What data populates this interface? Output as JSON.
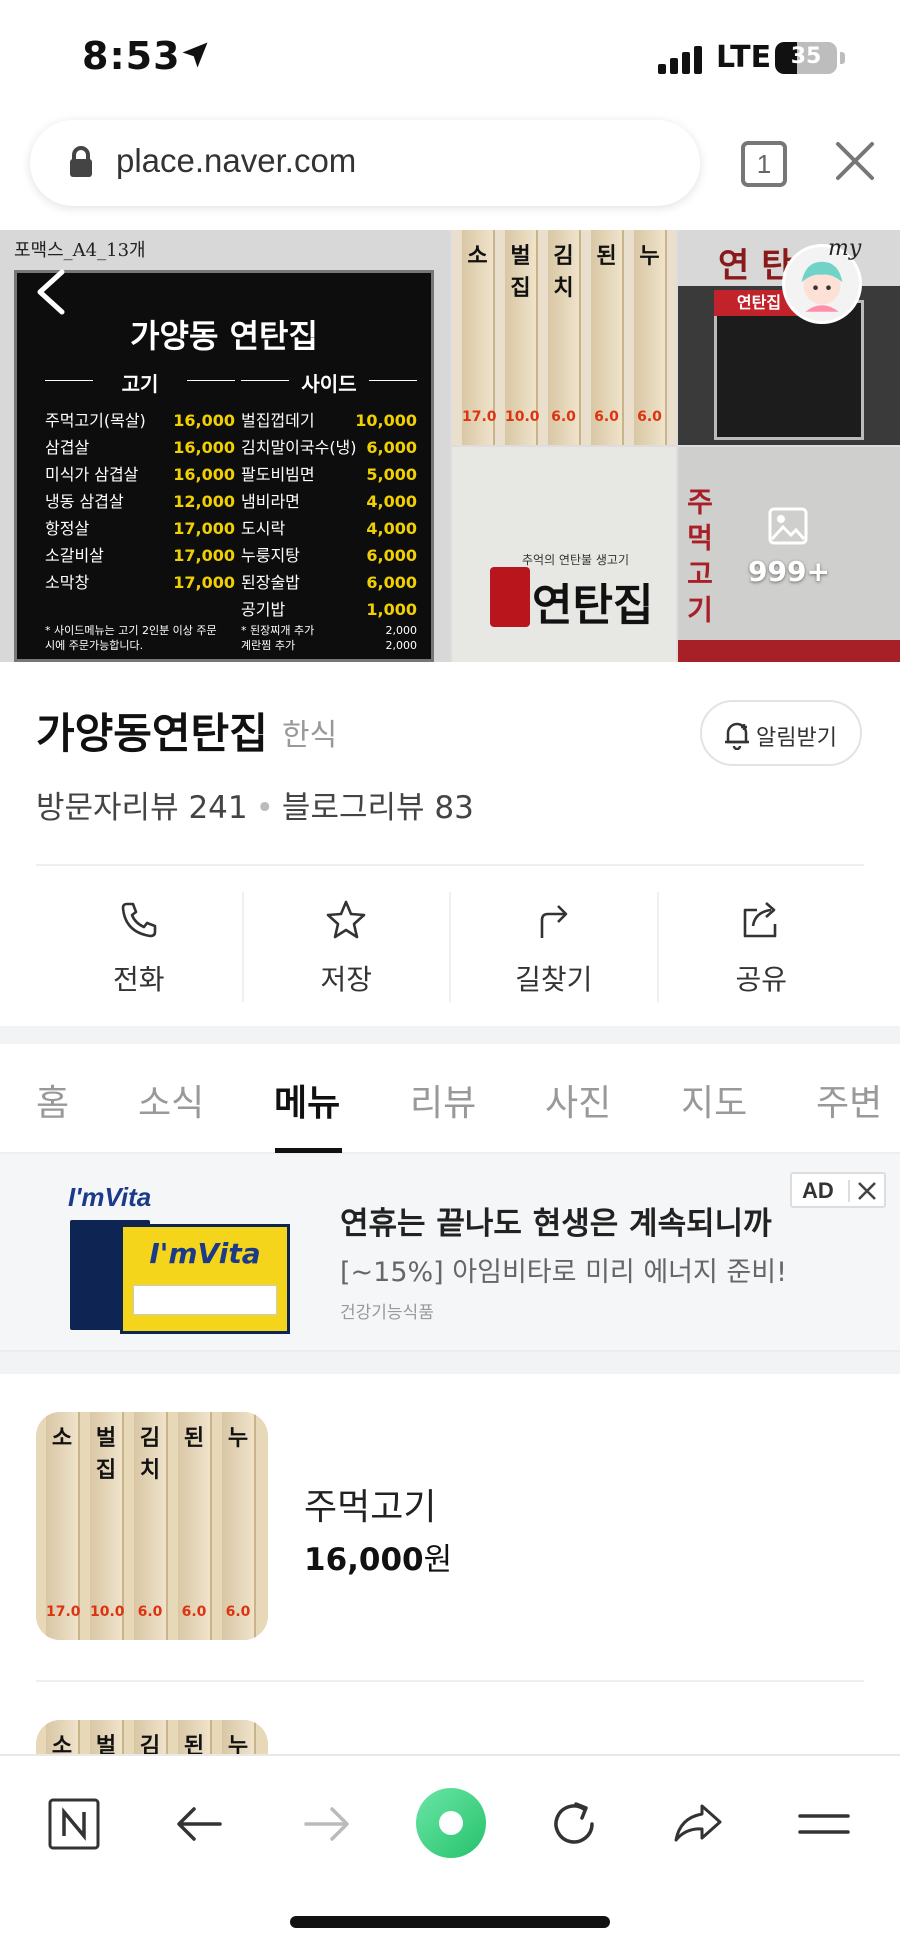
{
  "status_bar": {
    "time": "8:53",
    "network": "LTE",
    "battery_level": "35",
    "battery_fraction": 0.35
  },
  "browser": {
    "url": "place.naver.com",
    "tab_count": "1"
  },
  "photos": {
    "poster_caption": "포맥스_A4_13개",
    "poster_title": "가양동 연탄집",
    "meat_heading": "고기",
    "side_heading": "사이드",
    "meat_items": [
      {
        "name": "주먹고기(목살)",
        "price": "16,000"
      },
      {
        "name": "삼겹살",
        "price": "16,000"
      },
      {
        "name": "미식가 삼겹살",
        "price": "16,000"
      },
      {
        "name": "냉동 삼겹살",
        "price": "12,000"
      },
      {
        "name": "항정살",
        "price": "17,000"
      },
      {
        "name": "소갈비살",
        "price": "17,000"
      },
      {
        "name": "소막창",
        "price": "17,000"
      }
    ],
    "side_items": [
      {
        "name": "벌집껍데기",
        "price": "10,000"
      },
      {
        "name": "김치말이국수(냉)",
        "price": "6,000"
      },
      {
        "name": "팔도비빔면",
        "price": "5,000"
      },
      {
        "name": "냄비라면",
        "price": "4,000"
      },
      {
        "name": "도시락",
        "price": "4,000"
      },
      {
        "name": "누룽지탕",
        "price": "6,000"
      },
      {
        "name": "된장술밥",
        "price": "6,000"
      },
      {
        "name": "공기밥",
        "price": "1,000"
      }
    ],
    "poster_note_left": "* 사이드메뉴는 고기 2인분 이상 주문시에 주문가능합니다.",
    "poster_note_right": [
      {
        "name": "* 된장찌개 추가",
        "price": "2,000"
      },
      {
        "name": "계란찜 추가",
        "price": "2,000"
      }
    ],
    "strip_chars": [
      "소",
      "벌집",
      "김치",
      "된",
      "누"
    ],
    "strip_prices": [
      "17.0",
      "10.0",
      "6.0",
      "6.0",
      "6.0"
    ],
    "store_sign": "연탄집",
    "store_banner": "연탄집",
    "my_label": "my",
    "wall_small_text": "추억의 연탄불 생고기",
    "wall_big_text": "연탄집",
    "red_chars": "주먹고기",
    "more_count": "999+"
  },
  "place": {
    "name": "가양동연탄집",
    "category": "한식",
    "alarm_label": "알림받기",
    "visitor_reviews": "방문자리뷰 241",
    "blog_reviews": "블로그리뷰 83"
  },
  "actions": [
    {
      "label": "전화",
      "icon": "phone-icon"
    },
    {
      "label": "저장",
      "icon": "star-icon"
    },
    {
      "label": "길찾기",
      "icon": "directions-icon"
    },
    {
      "label": "공유",
      "icon": "share-icon"
    }
  ],
  "tabs": [
    {
      "label": "홈",
      "active": false
    },
    {
      "label": "소식",
      "active": false
    },
    {
      "label": "메뉴",
      "active": true
    },
    {
      "label": "리뷰",
      "active": false
    },
    {
      "label": "사진",
      "active": false
    },
    {
      "label": "지도",
      "active": false
    },
    {
      "label": "주변",
      "active": false
    }
  ],
  "ad": {
    "brand": "I'mVita",
    "title": "연휴는 끝나도 현생은 계속되니까",
    "description": "[~15%] 아임비타로 미리 에너지 준비!",
    "sub": "건강기능식품",
    "tag": "AD"
  },
  "menu_items": [
    {
      "name": "주먹고기",
      "price_value": "16,000",
      "price_unit": "원"
    }
  ],
  "colors": {
    "accent_green": "#25c26a",
    "poster_price": "#f0d000",
    "red": "#c0252d"
  }
}
